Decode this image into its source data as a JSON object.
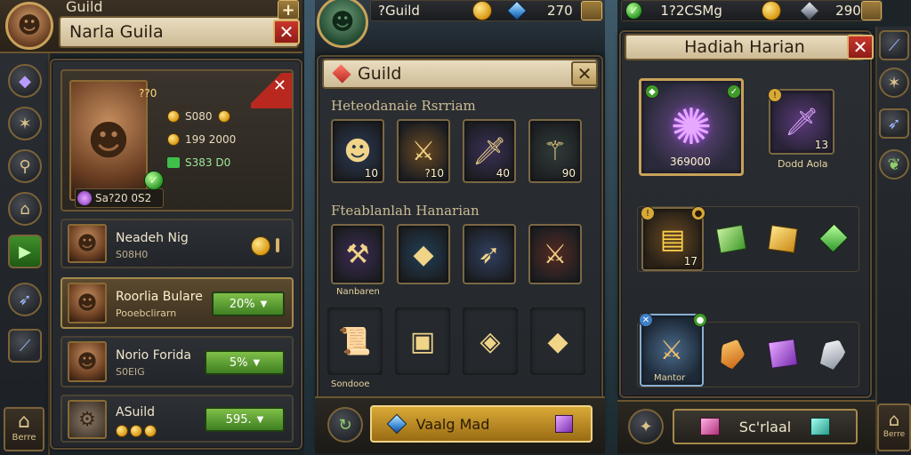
{
  "left": {
    "top_title": "Guild",
    "title": "Narla Guila",
    "profile": {
      "level": "??0",
      "stat1": "S080",
      "stat2": "199 2000",
      "stat3": "S383 D0",
      "name": "Sa?20 0S2"
    },
    "rows": [
      {
        "name": "Neadeh Nig",
        "sub": "S08H0",
        "value": "",
        "active": false
      },
      {
        "name": "Roorlia Bulare",
        "sub": "Pooebclirarn",
        "value": "20%",
        "active": true
      },
      {
        "name": "Norio Forida",
        "sub": "S0EIG",
        "value": "5%",
        "active": false
      },
      {
        "name": "ASuild",
        "sub": "",
        "value": "595.",
        "active": false
      }
    ],
    "home_label": "Berre"
  },
  "middle": {
    "topbar": {
      "name": "?Guild",
      "amount": "270"
    },
    "title": "Guild",
    "section1": "Heteodanaie Rsrriam",
    "section2": "Fteablanlah Hanarian",
    "slots_row1": [
      {
        "icon": "hero-icon",
        "glyph": "☻",
        "num": "10",
        "bg": "#2c3a55"
      },
      {
        "icon": "sword-icon",
        "glyph": "⚔",
        "num": "?10",
        "bg": "#6a4a22"
      },
      {
        "icon": "dagger-icon",
        "glyph": "🗡",
        "num": "40",
        "bg": "#3a2f55"
      },
      {
        "icon": "claw-icon",
        "glyph": "⚚",
        "num": "90",
        "bg": "#2f3b38"
      }
    ],
    "slots_row2": [
      {
        "icon": "staff-icon",
        "glyph": "⚒",
        "num": "",
        "bg": "#3d2a55",
        "label": "Nanbaren"
      },
      {
        "icon": "crystal-blade-icon",
        "glyph": "◆",
        "num": "",
        "bg": "#203f55"
      },
      {
        "icon": "spear-icon",
        "glyph": "➶",
        "num": "",
        "bg": "#2f3f60"
      },
      {
        "icon": "axe-icon",
        "glyph": "⚔",
        "num": "",
        "bg": "#552a22"
      }
    ],
    "slots_row3": [
      {
        "icon": "scroll-icon",
        "glyph": "📜",
        "label": "Sondooe"
      },
      {
        "icon": "chest-icon",
        "glyph": "▣"
      },
      {
        "icon": "cube-icon",
        "glyph": "◈"
      },
      {
        "icon": "purple-cube-icon",
        "glyph": "◆"
      }
    ],
    "bottom_btn": "Vaalg Mad"
  },
  "right": {
    "topbar": {
      "name": "1?2CSMg",
      "amount": "290"
    },
    "title": "Hadiah Harian",
    "featured": {
      "num": "369000",
      "glyph": "✺"
    },
    "feature2": {
      "num": "13",
      "label": "Dodd Aola"
    },
    "gold_slot_num": "17",
    "bottom_btn": "Sc'rlaal",
    "home_label": "Berre"
  },
  "colors": {
    "gold": "#d99a14",
    "green": "#5fa83a",
    "red": "#b8281f"
  }
}
